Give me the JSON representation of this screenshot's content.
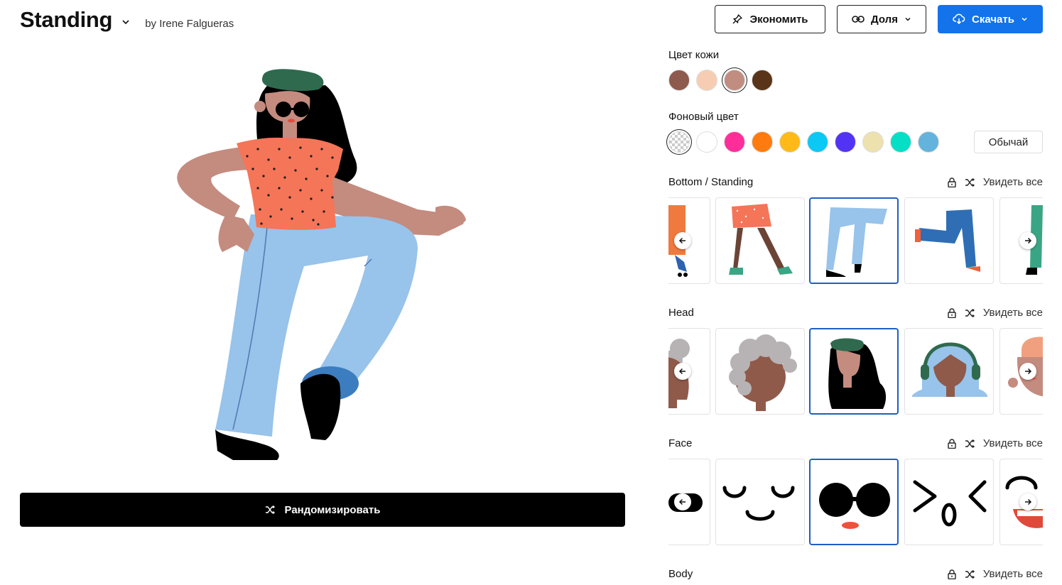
{
  "header": {
    "title": "Standing",
    "author": "by Irene Falgueras"
  },
  "actions": {
    "save_label": "Экономить",
    "share_label": "Доля",
    "download_label": "Скачать"
  },
  "randomize_label": "Рандомизировать",
  "skin": {
    "label": "Цвет кожи",
    "colors": [
      "#8e5a4d",
      "#f6cdb3",
      "#c08d80",
      "#5a3418"
    ],
    "selected": 2
  },
  "background": {
    "label": "Фоновый цвет",
    "colors": [
      "transparent",
      "#ffffff",
      "#ff2d9a",
      "#ff7b0f",
      "#ffba18",
      "#0bc8f5",
      "#5233f5",
      "#ede1ae",
      "#05dfc6",
      "#63b3dc"
    ],
    "selected": 0,
    "plain_label": "Обычай"
  },
  "categories": [
    {
      "name": "Bottom / Standing",
      "see_all": "Увидеть все"
    },
    {
      "name": "Head",
      "see_all": "Увидеть все"
    },
    {
      "name": "Face",
      "see_all": "Увидеть все"
    },
    {
      "name": "Body",
      "see_all": "Увидеть все"
    }
  ],
  "colors": {
    "accent": "#1273eb",
    "selected_border": "#1f5fc4"
  }
}
